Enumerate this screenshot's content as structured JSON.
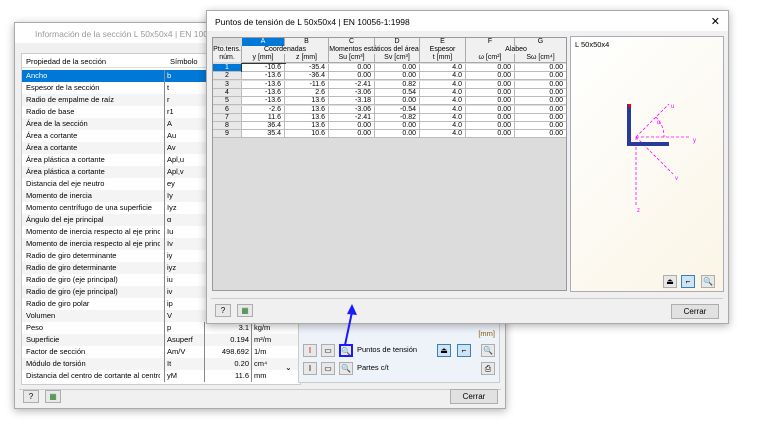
{
  "back_dialog": {
    "title": "Información de la sección L 50x50x4 | EN 10056-1:1998",
    "columns": [
      "Propiedad de la sección",
      "Símbolo"
    ],
    "rows": [
      {
        "p": "Ancho",
        "s": "b",
        "v": "",
        "u": ""
      },
      {
        "p": "Espesor de la sección",
        "s": "t",
        "v": "",
        "u": ""
      },
      {
        "p": "Radio de empalme de raíz",
        "s": "r",
        "v": "",
        "u": ""
      },
      {
        "p": "Radio de base",
        "s": "r1",
        "v": "",
        "u": ""
      },
      {
        "p": "Área de la sección",
        "s": "A",
        "v": "",
        "u": ""
      },
      {
        "p": "Área a cortante",
        "s": "Au",
        "v": "",
        "u": ""
      },
      {
        "p": "Área a cortante",
        "s": "Av",
        "v": "",
        "u": ""
      },
      {
        "p": "Área plástica a cortante",
        "s": "Apl,u",
        "v": "",
        "u": ""
      },
      {
        "p": "Área plástica a cortante",
        "s": "Apl,v",
        "v": "",
        "u": ""
      },
      {
        "p": "Distancia del eje neutro",
        "s": "ey",
        "v": "",
        "u": ""
      },
      {
        "p": "Momento de inercia",
        "s": "Iy",
        "v": "",
        "u": ""
      },
      {
        "p": "Momento centrífugo de una superficie",
        "s": "Iyz",
        "v": "",
        "u": ""
      },
      {
        "p": "Ángulo del eje principal",
        "s": "α",
        "v": "",
        "u": ""
      },
      {
        "p": "Momento de inercia respecto al eje princip",
        "s": "Iu",
        "v": "",
        "u": ""
      },
      {
        "p": "Momento de inercia respecto al eje princip",
        "s": "Iv",
        "v": "",
        "u": ""
      },
      {
        "p": "Radio de giro determinante",
        "s": "iy",
        "v": "",
        "u": ""
      },
      {
        "p": "Radio de giro determinante",
        "s": "iyz",
        "v": "",
        "u": ""
      },
      {
        "p": "Radio de giro (eje principal)",
        "s": "iu",
        "v": "",
        "u": ""
      },
      {
        "p": "Radio de giro (eje principal)",
        "s": "iv",
        "v": "",
        "u": ""
      },
      {
        "p": "Radio de giro polar",
        "s": "ip",
        "v": "",
        "u": ""
      },
      {
        "p": "Volumen",
        "s": "V",
        "v": "",
        "u": ""
      },
      {
        "p": "Peso",
        "s": "p",
        "v": "3.1",
        "u": "kg/m"
      },
      {
        "p": "Superficie",
        "s": "Asuperf",
        "v": "0.194",
        "u": "m²/m"
      },
      {
        "p": "Factor de sección",
        "s": "Am/V",
        "v": "498.692",
        "u": "1/m"
      },
      {
        "p": "Módulo de torsión",
        "s": "It",
        "v": "0.20",
        "u": "cm⁴"
      },
      {
        "p": "Distancia del centro de cortante al centro",
        "s": "yM",
        "v": "11.6",
        "u": "mm"
      }
    ],
    "unit_label": "[mm]",
    "stress_points": "Puntos de tensión",
    "ct_parts": "Partes c/t",
    "close": "Cerrar"
  },
  "front_dialog": {
    "title": "Puntos de tensión de L 50x50x4 | EN 10056-1:1998",
    "col_letters": [
      "A",
      "B",
      "C",
      "D",
      "E",
      "F",
      "G"
    ],
    "group_headers": [
      "Pto.tens. núm.",
      "Coordenadas",
      "Momentos estáticos del área",
      "Espesor",
      "Alabeo"
    ],
    "col_headers": [
      "y [mm]",
      "z [mm]",
      "Su [cm³]",
      "Sv [cm³]",
      "t [mm]",
      "ω [cm²]",
      "Sω [cm⁴]"
    ],
    "rows": [
      [
        "1",
        "-10.6",
        "-35.4",
        "0.00",
        "0.00",
        "4.0",
        "0.00",
        "0.00"
      ],
      [
        "2",
        "-13.6",
        "-36.4",
        "0.00",
        "0.00",
        "4.0",
        "0.00",
        "0.00"
      ],
      [
        "3",
        "-13.6",
        "-11.6",
        "-2.41",
        "0.82",
        "4.0",
        "0.00",
        "0.00"
      ],
      [
        "4",
        "-13.6",
        "2.6",
        "-3.06",
        "0.54",
        "4.0",
        "0.00",
        "0.00"
      ],
      [
        "5",
        "-13.6",
        "13.6",
        "-3.18",
        "0.00",
        "4.0",
        "0.00",
        "0.00"
      ],
      [
        "6",
        "-2.6",
        "13.6",
        "-3.06",
        "-0.54",
        "4.0",
        "0.00",
        "0.00"
      ],
      [
        "7",
        "11.6",
        "13.6",
        "-2.41",
        "-0.82",
        "4.0",
        "0.00",
        "0.00"
      ],
      [
        "8",
        "36.4",
        "13.6",
        "0.00",
        "0.00",
        "4.0",
        "0.00",
        "0.00"
      ],
      [
        "9",
        "35.4",
        "10.6",
        "0.00",
        "0.00",
        "4.0",
        "0.00",
        "0.00"
      ]
    ],
    "preview_label": "L 50x50x4",
    "close": "Cerrar"
  },
  "colors": {
    "selection": "#0078d7",
    "accent_arrow": "#1a1aff",
    "axes": "#ff00ff"
  }
}
